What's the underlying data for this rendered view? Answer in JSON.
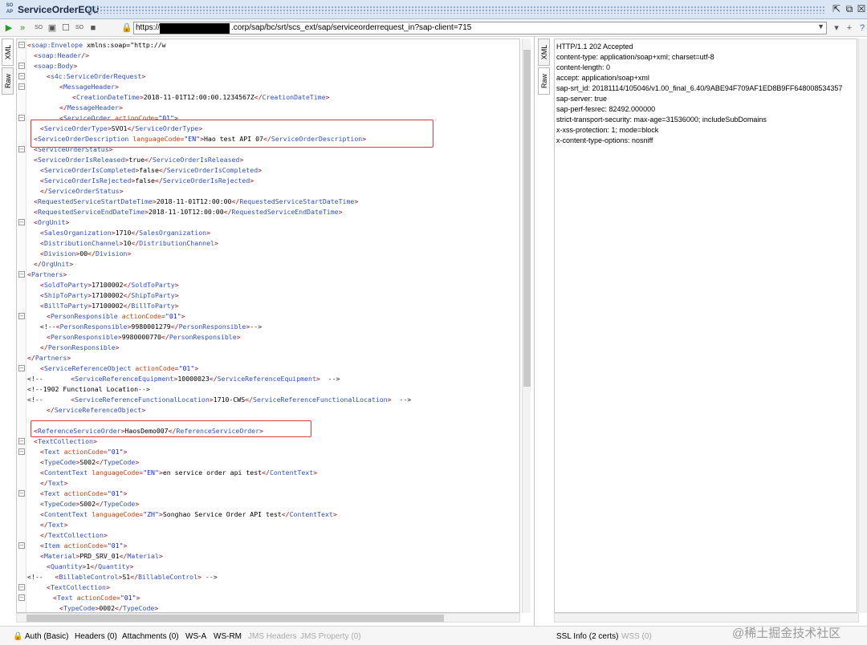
{
  "window": {
    "title": "ServiceOrderEQU",
    "icon_text": "SO AP"
  },
  "toolbar": {
    "url_prefix": "https://",
    "url_rest": ".corp/sap/bc/srt/scs_ext/sap/serviceorderrequest_in?sap-client=715"
  },
  "left_pane": {
    "tabs": [
      "XML",
      "Raw"
    ],
    "lines": [
      {
        "t": "<soap:Envelope xmlns:soap=\"http://w",
        "fold": "-",
        "ind": 0
      },
      {
        "t": "<soap:Header/>",
        "ind": 1
      },
      {
        "t": "<soap:Body>",
        "fold": "-",
        "ind": 1
      },
      {
        "t": "<s4c:ServiceOrderRequest>",
        "fold": "-",
        "ind": 3
      },
      {
        "t": "<MessageHeader>",
        "fold": "-",
        "ind": 5
      },
      {
        "t": "<CreationDateTime>2018-11-01T12:00:00.1234567Z</CreationDateTime>",
        "ind": 7
      },
      {
        "t": "</MessageHeader>",
        "ind": 5
      },
      {
        "t": "<ServiceOrder actionCode=\"01\">",
        "fold": "-",
        "ind": 5
      },
      {
        "t": "<ServiceOrderType>SVO1</ServiceOrderType>",
        "ind": 2
      },
      {
        "t": "<ServiceOrderDescription languageCode=\"EN\">Hao test API 07</ServiceOrderDescription>",
        "ind": 1
      },
      {
        "t": "<ServiceOrderStatus>",
        "fold": "-",
        "ind": 1
      },
      {
        "t": "<ServiceOrderIsReleased>true</ServiceOrderIsReleased>",
        "ind": 1
      },
      {
        "t": "<ServiceOrderIsCompleted>false</ServiceOrderIsCompleted>",
        "ind": 2
      },
      {
        "t": "<ServiceOrderIsRejected>false</ServiceOrderIsRejected>",
        "ind": 2
      },
      {
        "t": "</ServiceOrderStatus>",
        "ind": 2
      },
      {
        "t": "<RequestedServiceStartDateTime>2018-11-01T12:00:00</RequestedServiceStartDateTime>",
        "ind": 1
      },
      {
        "t": "<RequestedServiceEndDateTime>2018-11-10T12:00:00</RequestedServiceEndDateTime>",
        "ind": 1
      },
      {
        "t": "<OrgUnit>",
        "fold": "-",
        "ind": 1
      },
      {
        "t": "<SalesOrganization>1710</SalesOrganization>",
        "ind": 2
      },
      {
        "t": "<DistributionChannel>10</DistributionChannel>",
        "ind": 2
      },
      {
        "t": "<Division>00</Division>",
        "ind": 2
      },
      {
        "t": "</OrgUnit>",
        "ind": 1
      },
      {
        "t": "<Partners>",
        "fold": "-",
        "ind": 0
      },
      {
        "t": "<SoldToParty>17100002</SoldToParty>",
        "ind": 2
      },
      {
        "t": "<ShipToParty>17100002</ShipToParty>",
        "ind": 2
      },
      {
        "t": "<BillToParty>17100002</BillToParty>",
        "ind": 2
      },
      {
        "t": "<PersonResponsible actionCode=\"01\">",
        "fold": "-",
        "ind": 3
      },
      {
        "t": "<!--<PersonResponsible>9980001279</PersonResponsible>-->",
        "ind": 2
      },
      {
        "t": "<PersonResponsible>9980000770</PersonResponsible>",
        "ind": 3
      },
      {
        "t": "</PersonResponsible>",
        "ind": 2
      },
      {
        "t": "</Partners>",
        "ind": 0
      },
      {
        "t": "<ServiceReferenceObject actionCode=\"01\">",
        "fold": "-",
        "ind": 2
      },
      {
        "t": "<!--       <ServiceReferenceEquipment>10000023</ServiceReferenceEquipment>  -->",
        "ind": 0
      },
      {
        "t": "<!--1902 Functional Location-->",
        "ind": 0
      },
      {
        "t": "<!--       <ServiceReferenceFunctionalLocation>1710-CWS</ServiceReferenceFunctionalLocation>  -->",
        "ind": 0
      },
      {
        "t": "</ServiceReferenceObject>",
        "ind": 3
      },
      {
        "t": "",
        "ind": 0
      },
      {
        "t": "<ReferenceServiceOrder>HaosDemo007</ReferenceServiceOrder>",
        "ind": 1
      },
      {
        "t": "<TextCollection>",
        "fold": "-",
        "ind": 1
      },
      {
        "t": "<Text actionCode=\"01\">",
        "fold": "-",
        "ind": 2
      },
      {
        "t": "<TypeCode>S002</TypeCode>",
        "ind": 2
      },
      {
        "t": "<ContentText languageCode=\"EN\">en service order api test</ContentText>",
        "ind": 2
      },
      {
        "t": "</Text>",
        "ind": 2
      },
      {
        "t": "<Text actionCode=\"01\">",
        "fold": "-",
        "ind": 2
      },
      {
        "t": "<TypeCode>S002</TypeCode>",
        "ind": 2
      },
      {
        "t": "<ContentText languageCode=\"ZH\">Songhao Service Order API test</ContentText>",
        "ind": 2
      },
      {
        "t": "</Text>",
        "ind": 2
      },
      {
        "t": "</TextCollection>",
        "ind": 2
      },
      {
        "t": "<Item actionCode=\"01\">",
        "fold": "-",
        "ind": 2
      },
      {
        "t": "<Material>PRD_SRV_01</Material>",
        "ind": 2
      },
      {
        "t": "<Quantity>1</Quantity>",
        "ind": 3
      },
      {
        "t": "<!--   <BillableControl>S1</BillableControl> -->",
        "ind": 0
      },
      {
        "t": "<TextCollection>",
        "fold": "-",
        "ind": 3
      },
      {
        "t": "<Text actionCode=\"01\">",
        "fold": "-",
        "ind": 4
      },
      {
        "t": "<TypeCode>0002</TypeCode>",
        "ind": 5
      }
    ]
  },
  "right_pane": {
    "tabs": [
      "XML",
      "Raw"
    ],
    "lines": [
      "HTTP/1.1 202 Accepted",
      "content-type: application/soap+xml; charset=utf-8",
      "content-length: 0",
      "accept: application/soap+xml",
      "sap-srt_id: 20181114/105046/v1.00_final_6.40/9ABE94F709AF1ED8B9FF648008534357",
      "sap-server: true",
      "sap-perf-fesrec: 82492.000000",
      "strict-transport-security: max-age=31536000; includeSubDomains",
      "x-xss-protection: 1; mode=block",
      "x-content-type-options: nosniff"
    ]
  },
  "statusbar": {
    "auth": "Auth (Basic)",
    "headers": "Headers (0)",
    "attachments": "Attachments (0)",
    "wsa": "WS-A",
    "wsrm": "WS-RM",
    "jms_headers": "JMS Headers",
    "jms_property": "JMS Property (0)",
    "ssl": "SSL Info (2 certs)",
    "wss": "WSS (0)"
  },
  "watermark": "@稀土掘金技术社区",
  "colors": {
    "tag": "#a31515",
    "attr": "#c94010",
    "value": "#1526c9",
    "highlight": "#e03a3a"
  }
}
